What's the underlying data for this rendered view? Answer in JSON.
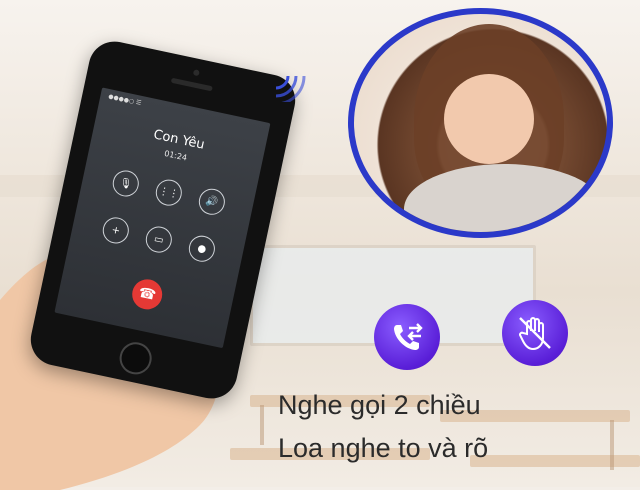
{
  "call_screen": {
    "status_bar": "●●●●○  ☰",
    "caller_name": "Con Yêu",
    "call_duration": "01:24"
  },
  "features": {
    "line1": "Nghe gọi 2 chiều",
    "line2": "Loa nghe to và rõ"
  },
  "icons": {
    "feature_1": "two-way-call-icon",
    "feature_2": "hand-wave-icon"
  },
  "colors": {
    "accent_purple": "#5a1fd8",
    "photo_border": "#2b39c9",
    "end_call_red": "#e53935"
  }
}
